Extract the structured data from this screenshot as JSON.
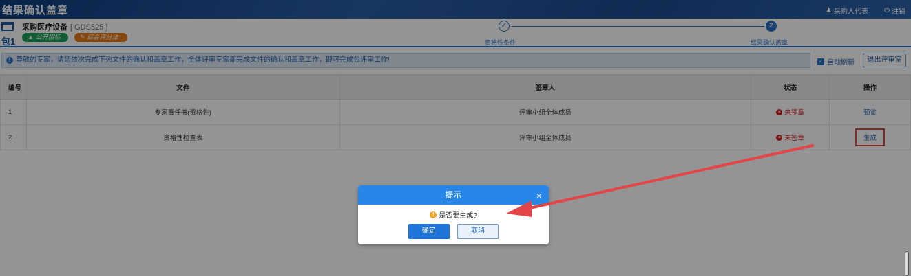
{
  "header": {
    "title": "结果确认盖章",
    "user": "采购人代表",
    "logout": "注销"
  },
  "package": {
    "no": "包1",
    "name": "采购医疗设备",
    "code": "[ GDS525 ]",
    "tag_bidding": "公开招标",
    "tag_method": "综合评分法"
  },
  "steps": [
    {
      "label": "资格性条件",
      "marker": "✓"
    },
    {
      "label": "结果确认盖章",
      "marker": "2"
    }
  ],
  "notice": {
    "text": "尊敬的专家，请您依次完成下列文件的确认和盖章工作，全体评审专家都完成文件的确认和盖章工作，即可完成包评审工作!",
    "auto_refresh": "自动刷新",
    "exit_button": "退出评审室"
  },
  "table": {
    "headers": [
      "编号",
      "文件",
      "签章人",
      "状态",
      "操作"
    ],
    "rows": [
      {
        "no": "1",
        "file": "专家责任书(资格性)",
        "signer": "评审小组全体成员",
        "status": "未签章",
        "action": "预览"
      },
      {
        "no": "2",
        "file": "资格性检查表",
        "signer": "评审小组全体成员",
        "status": "未签章",
        "action": "生成"
      }
    ]
  },
  "dialog": {
    "title": "提示",
    "message": "是否要生成?",
    "ok": "确定",
    "cancel": "取消"
  },
  "colors": {
    "primary": "#2b73c9",
    "status_red": "#d21c1c",
    "annotation_red": "#e24545"
  }
}
